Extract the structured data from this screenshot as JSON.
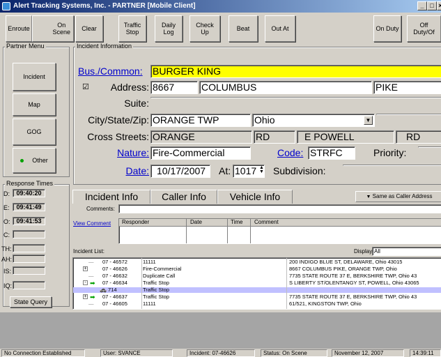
{
  "window": {
    "title": "Alert Tracking Systems, Inc. - PARTNER [Mobile Client]"
  },
  "toolbar": {
    "enroute": "Enroute",
    "on_scene": "On\nScene",
    "clear": "Clear",
    "traffic_stop": "Traffic\nStop",
    "daily_log": "Daily\nLog",
    "check_up": "Check\nUp",
    "beat": "Beat",
    "out_at": "Out At",
    "on_duty": "On Duty",
    "off_duty": "Off\nDuty/Of"
  },
  "partner_menu": {
    "label": "Partner Menu",
    "incident": "Incident",
    "map": "Map",
    "gog": "GOG",
    "other": "Other"
  },
  "response_times": {
    "label": "Response Times",
    "d_label": "D:",
    "d_value": "09:40:20",
    "e_label": "E:",
    "e_value": "09:41:49",
    "o_label": "O:",
    "o_value": "09:41:53",
    "c_label": "C:",
    "c_value": "",
    "th_label": "TH:",
    "th_value": "",
    "ah_label": "AH:",
    "ah_value": "",
    "is_label": "IS:",
    "is_value": "",
    "iq_label": "IQ:",
    "iq_value": "",
    "state_query": "State Query"
  },
  "incident_info": {
    "label": "Incident Information",
    "bus_common_label": "Bus./Common:",
    "bus_common_value": "BURGER KING",
    "address_check": "☑",
    "address_label": "Address:",
    "address_number": "8667",
    "address_street": "COLUMBUS",
    "address_type": "PIKE",
    "suite_label": "Suite:",
    "suite_value": "",
    "city_label": "City/State/Zip:",
    "city_value": "ORANGE TWP",
    "state_value": "Ohio",
    "zip_value": "",
    "cross_label": "Cross Streets:",
    "cross1_name": "ORANGE",
    "cross1_type": "RD",
    "cross2_name": "E POWELL",
    "cross2_type": "RD",
    "nature_label": "Nature:",
    "nature_value": "Fire-Commercial",
    "code_label": "Code:",
    "code_value": "STRFC",
    "priority_label": "Priority:",
    "priority_value": "",
    "date_label": "Date:",
    "date_value": "10/17/2007",
    "at_label": "At:",
    "at_value": "1017",
    "subdivision_label": "Subdivision:",
    "subdivision_value": ""
  },
  "tabs": {
    "incident_info": "Incident Info",
    "caller_info": "Caller Info",
    "vehicle_info": "Vehicle Info",
    "same_as_caller": "Same as Caller Address"
  },
  "comments": {
    "label": "Comments:",
    "value": "",
    "view_comment": "View Comment",
    "headers": [
      "Responder",
      "Date",
      "Time",
      "Comment"
    ]
  },
  "incident_list": {
    "label": "Incident List:",
    "display_label": "Display",
    "display_value": "All",
    "rows": [
      {
        "tree": "",
        "number": "07 - 46572",
        "nature": "11111",
        "address": "200 INDIGO BLUE ST, DELAWARE, Ohio 43015"
      },
      {
        "tree": "+",
        "number": "07 - 46626",
        "nature": "Fire-Commercial",
        "address": "8667 COLUMBUS PIKE, ORANGE TWP, Ohio"
      },
      {
        "tree": "",
        "number": "07 - 46632",
        "nature": "Duplicate Call",
        "address": "7735 STATE ROUTE 37 E, BERKSHIRE TWP, Ohio 43"
      },
      {
        "tree": "-",
        "number": "07 - 46634",
        "nature": "Traffic Stop",
        "address": "S LIBERTY ST/OLENTANGY ST, POWELL, Ohio 43065"
      },
      {
        "tree": "car",
        "number": "714",
        "nature": "Traffic Stop",
        "address": ""
      },
      {
        "tree": "+",
        "number": "07 - 46637",
        "nature": "Traffic Stop",
        "address": "7735 STATE ROUTE 37 E, BERKSHIRE TWP, Ohio 43"
      },
      {
        "tree": "",
        "number": "07 - 46605",
        "nature": "11111",
        "address": "61/521, KINGSTON TWP, Ohio"
      }
    ]
  },
  "status_bar": {
    "connection": "No Connection Established",
    "user": "User: SVANCE",
    "incident": "Incident: 07-46626",
    "status": "Status: On Scene",
    "date": "November 12, 2007",
    "time": "14:39:11"
  },
  "colors": {
    "title_bar": "#0a246a",
    "highlight_field": "#ffff00",
    "link": "#0000cc",
    "arrow": "#00a000"
  }
}
